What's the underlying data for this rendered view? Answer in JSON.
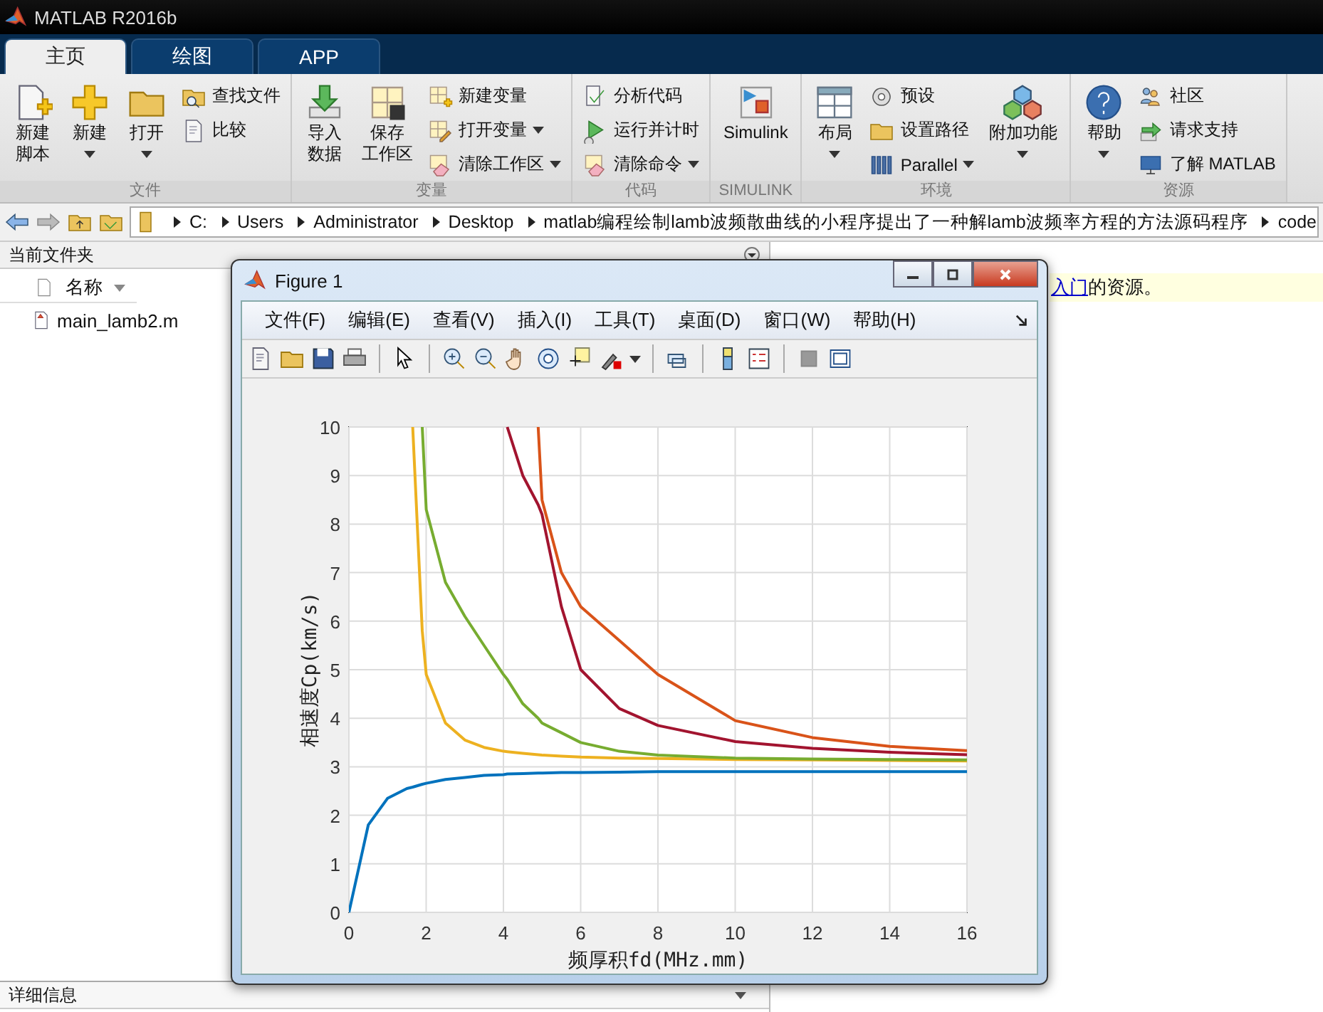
{
  "app": {
    "title": "MATLAB R2016b"
  },
  "tabs": [
    {
      "label": "主页",
      "selected": true
    },
    {
      "label": "绘图",
      "selected": false
    },
    {
      "label": "APP",
      "selected": false
    }
  ],
  "ribbon": [
    {
      "label": "文件",
      "columns": [
        {
          "kind": "large",
          "lines": [
            "新建",
            "脚本"
          ],
          "dropdown": false
        },
        {
          "kind": "large",
          "lines": [
            "新建"
          ],
          "dropdown": true
        },
        {
          "kind": "large",
          "lines": [
            "打开"
          ],
          "dropdown": true
        },
        {
          "kind": "stack",
          "items": [
            {
              "label": "查找文件",
              "dropdown": false
            },
            {
              "label": "比较",
              "dropdown": false
            }
          ]
        }
      ]
    },
    {
      "label": "变量",
      "columns": [
        {
          "kind": "large",
          "lines": [
            "导入",
            "数据"
          ],
          "dropdown": false
        },
        {
          "kind": "large",
          "lines": [
            "保存",
            "工作区"
          ],
          "dropdown": false
        },
        {
          "kind": "stack",
          "items": [
            {
              "label": "新建变量",
              "dropdown": false
            },
            {
              "label": "打开变量",
              "dropdown": true
            },
            {
              "label": "清除工作区",
              "dropdown": true
            }
          ]
        }
      ]
    },
    {
      "label": "代码",
      "columns": [
        {
          "kind": "stack",
          "items": [
            {
              "label": "分析代码",
              "dropdown": false
            },
            {
              "label": "运行并计时",
              "dropdown": false
            },
            {
              "label": "清除命令",
              "dropdown": true
            }
          ]
        }
      ]
    },
    {
      "label": "SIMULINK",
      "columns": [
        {
          "kind": "large",
          "lines": [
            "Simulink"
          ],
          "dropdown": false
        }
      ]
    },
    {
      "label": "环境",
      "columns": [
        {
          "kind": "large",
          "lines": [
            "布局"
          ],
          "dropdown": true
        },
        {
          "kind": "stack",
          "items": [
            {
              "label": "预设",
              "dropdown": false
            },
            {
              "label": "设置路径",
              "dropdown": false
            },
            {
              "label": "Parallel",
              "dropdown": true
            }
          ]
        },
        {
          "kind": "large",
          "lines": [
            "附加功能"
          ],
          "dropdown": true
        }
      ]
    },
    {
      "label": "资源",
      "columns": [
        {
          "kind": "large",
          "lines": [
            "帮助"
          ],
          "dropdown": true
        },
        {
          "kind": "stack",
          "items": [
            {
              "label": "社区",
              "dropdown": false
            },
            {
              "label": "请求支持",
              "dropdown": false
            },
            {
              "label": "了解 MATLAB",
              "dropdown": false
            }
          ]
        }
      ]
    }
  ],
  "address": {
    "segments": [
      "C:",
      "Users",
      "Administrator",
      "Desktop",
      "matlab编程绘制lamb波频散曲线的小程序提出了一种解lamb波频率方程的方法源码程序",
      "code"
    ]
  },
  "current_folder": {
    "title": "当前文件夹",
    "column": "名称",
    "files": [
      "main_lamb2.m"
    ],
    "details": "详细信息"
  },
  "command_window": {
    "link": "入门",
    "text": "的资源。"
  },
  "figure": {
    "title": "Figure 1",
    "menu": [
      "文件(F)",
      "编辑(E)",
      "查看(V)",
      "插入(I)",
      "工具(T)",
      "桌面(D)",
      "窗口(W)",
      "帮助(H)"
    ],
    "chart_data": {
      "type": "line",
      "xlabel": "频厚积fd(MHz.mm)",
      "ylabel": "相速度Cp(km/s)",
      "x": [
        0,
        0.5,
        1,
        1.5,
        1.65,
        1.9,
        2,
        2.5,
        3,
        3.5,
        4,
        4.1,
        4.5,
        4.9,
        5,
        5.5,
        6,
        7,
        8,
        10,
        12,
        14,
        16
      ],
      "series": [
        {
          "color": "#0072bd",
          "values": [
            0,
            1.8,
            2.35,
            2.55,
            2.58,
            2.64,
            2.66,
            2.74,
            2.78,
            2.82,
            2.84,
            2.85,
            2.86,
            2.87,
            2.87,
            2.88,
            2.88,
            2.89,
            2.9,
            2.9,
            2.9,
            2.9,
            2.9
          ]
        },
        {
          "color": "#edb120",
          "values": [
            null,
            null,
            null,
            null,
            10,
            5.8,
            4.9,
            3.9,
            3.55,
            3.4,
            3.32,
            3.31,
            3.28,
            3.25,
            3.24,
            3.22,
            3.2,
            3.18,
            3.17,
            3.15,
            3.14,
            3.13,
            3.12
          ]
        },
        {
          "color": "#77ac30",
          "values": [
            null,
            null,
            null,
            null,
            null,
            10,
            8.3,
            6.8,
            6.1,
            5.5,
            4.9,
            4.8,
            4.3,
            4.0,
            3.9,
            3.7,
            3.5,
            3.32,
            3.24,
            3.18,
            3.16,
            3.15,
            3.14
          ]
        },
        {
          "color": "#a2142f",
          "values": [
            null,
            null,
            null,
            null,
            null,
            null,
            null,
            null,
            null,
            null,
            null,
            10,
            9.0,
            8.4,
            8.2,
            6.3,
            5.0,
            4.2,
            3.85,
            3.52,
            3.38,
            3.3,
            3.25
          ]
        },
        {
          "color": "#d95319",
          "values": [
            null,
            null,
            null,
            null,
            null,
            null,
            null,
            null,
            null,
            null,
            null,
            null,
            null,
            10,
            8.5,
            7.0,
            6.3,
            5.6,
            4.9,
            3.95,
            3.6,
            3.42,
            3.33
          ]
        }
      ],
      "grid": true,
      "xlim": [
        0,
        16
      ],
      "ylim": [
        0,
        10
      ],
      "xticks": [
        0,
        2,
        4,
        6,
        8,
        10,
        12,
        14,
        16
      ],
      "yticks": [
        0,
        1,
        2,
        3,
        4,
        5,
        6,
        7,
        8,
        9,
        10
      ]
    }
  }
}
